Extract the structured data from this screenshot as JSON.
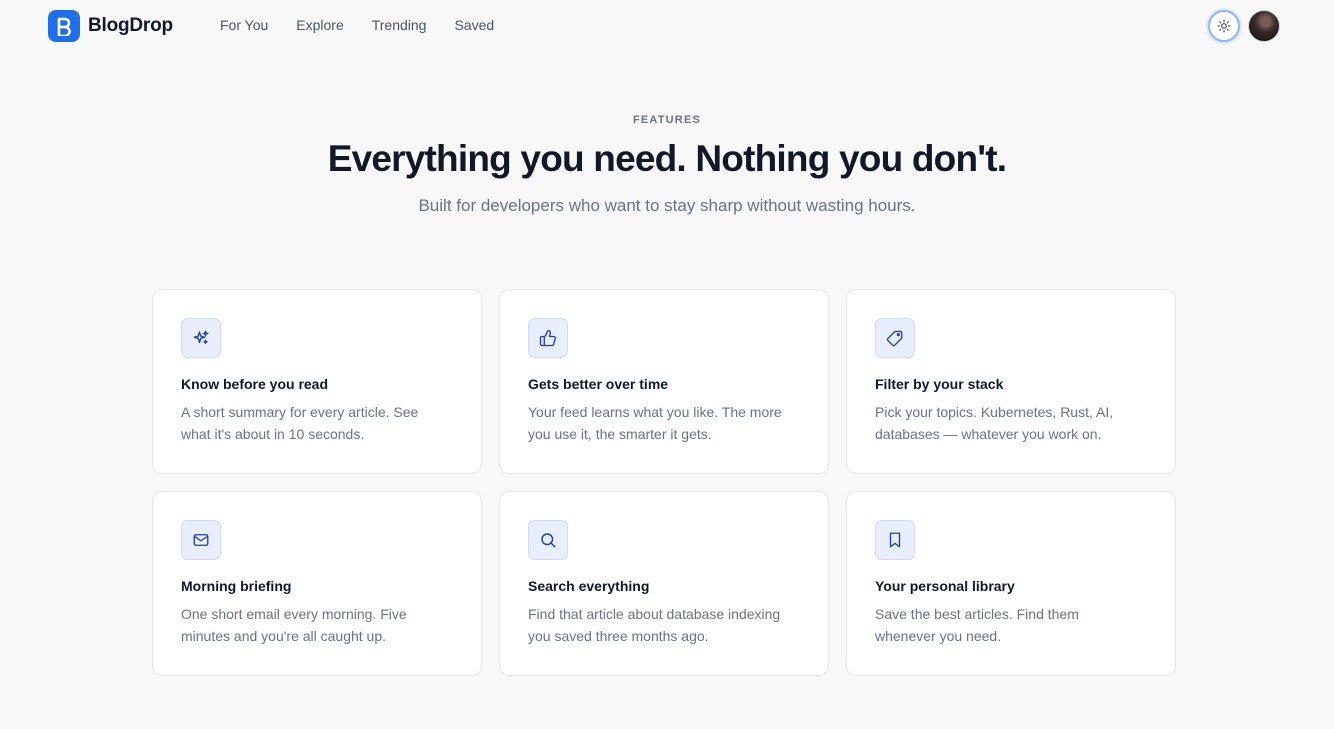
{
  "header": {
    "brand": "BlogDrop",
    "nav": [
      {
        "label": "For You"
      },
      {
        "label": "Explore"
      },
      {
        "label": "Trending"
      },
      {
        "label": "Saved"
      }
    ],
    "theme_icon": "sun-icon",
    "avatar_icon": "avatar"
  },
  "hero": {
    "eyebrow": "FEATURES",
    "title": "Everything you need. Nothing you don't.",
    "subtitle": "Built for developers who want to stay sharp without wasting hours."
  },
  "features": [
    {
      "icon": "sparkles-icon",
      "title": "Know before you read",
      "desc": "A short summary for every article. See what it's about in 10 seconds."
    },
    {
      "icon": "thumbs-up-icon",
      "title": "Gets better over time",
      "desc": "Your feed learns what you like. The more you use it, the smarter it gets."
    },
    {
      "icon": "tag-icon",
      "title": "Filter by your stack",
      "desc": "Pick your topics. Kubernetes, Rust, AI, databases — whatever you work on."
    },
    {
      "icon": "mail-icon",
      "title": "Morning briefing",
      "desc": "One short email every morning. Five minutes and you're all caught up."
    },
    {
      "icon": "search-icon",
      "title": "Search everything",
      "desc": "Find that article about database indexing you saved three months ago."
    },
    {
      "icon": "bookmark-icon",
      "title": "Your personal library",
      "desc": "Save the best articles. Find them whenever you need."
    }
  ],
  "colors": {
    "accent": "#1f6feb",
    "icon_bg": "#e8eefc",
    "icon_stroke": "#1e40af"
  }
}
